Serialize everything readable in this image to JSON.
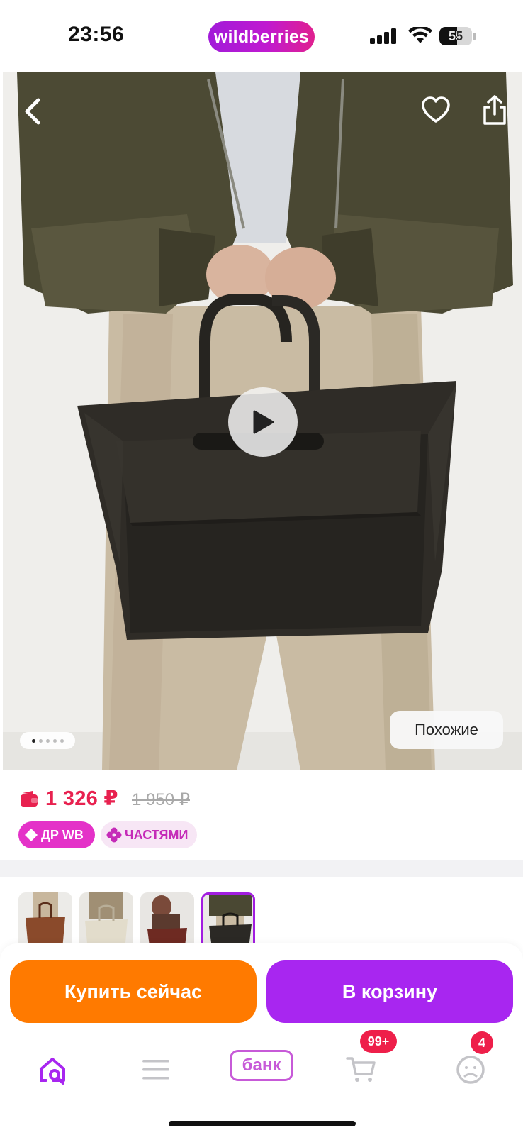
{
  "status_bar": {
    "time": "23:56",
    "brand": "wildberries",
    "battery_level": "55",
    "battery_fraction": 0.55
  },
  "product": {
    "similar_label": "Похожие",
    "gallery": {
      "image_count": 5,
      "active_index": 0
    }
  },
  "price": {
    "current": "1 326 ₽",
    "old": "1 950 ₽",
    "badges": [
      {
        "label": "ДР WB",
        "icon": "tag-icon"
      },
      {
        "label": "ЧАСТЯМИ",
        "icon": "flower-icon"
      }
    ]
  },
  "thumbnails": {
    "count": 4,
    "selected_index": 3
  },
  "actions": {
    "buy_now": "Купить сейчас",
    "add_to_cart": "В корзину"
  },
  "bottom_nav": {
    "bank_label": "банк",
    "cart_count": "99+",
    "profile_count": "4"
  },
  "colors": {
    "brand": "#a826f0",
    "price": "#e8214f",
    "buy": "#ff7a00",
    "cart": "#a826f0",
    "badge_dr": "#e432c8",
    "notification": "#ee1f4a"
  }
}
